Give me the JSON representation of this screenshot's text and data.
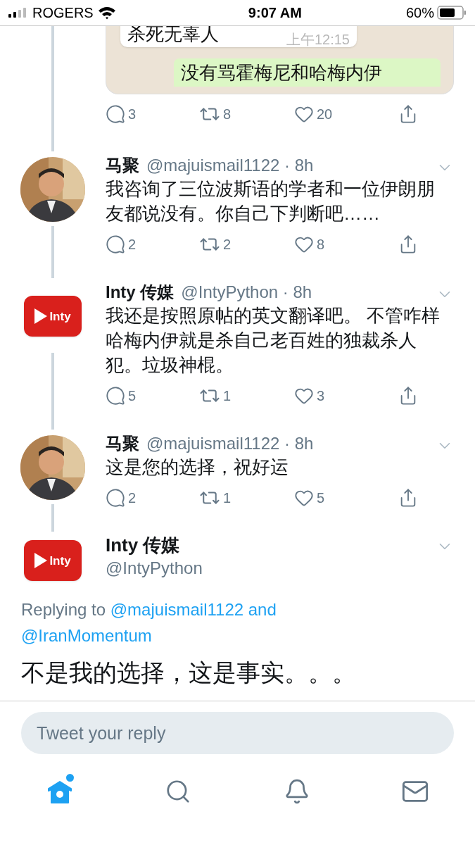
{
  "status_bar": {
    "carrier": "ROGERS",
    "time": "9:07 AM",
    "battery": "60%"
  },
  "embedded_chat": {
    "messages": [
      {
        "kind": "incoming",
        "text": "杀死无辜人",
        "time": "上午12:15"
      },
      {
        "kind": "outgoing",
        "text": "没有骂霍梅尼和哈梅内伊"
      }
    ]
  },
  "top_actions": {
    "replies": "3",
    "retweets": "8",
    "likes": "20"
  },
  "replies": [
    {
      "name": "马聚",
      "meta": "@majuismail1122 · 8h",
      "text": "我咨询了三位波斯语的学者和一位伊朗朋友都说没有。你自己下判断吧……",
      "replies": "2",
      "retweets": "2",
      "likes": "8"
    },
    {
      "avatar": {
        "kind": "logo",
        "logo_text": "Inty"
      },
      "name": "Inty 传媒",
      "meta": "@IntyPython · 8h",
      "text": "我还是按照原帖的英文翻译吧。 不管咋样哈梅内伊就是杀自己老百姓的独裁杀人犯。垃圾神棍。",
      "replies": "5",
      "retweets": "1",
      "likes": "3"
    },
    {
      "name": "马聚",
      "meta": "@majuismail1122 · 8h",
      "text": "这是您的选择，祝好运",
      "replies": "2",
      "retweets": "1",
      "likes": "5"
    }
  ],
  "main_tweet": {
    "avatar": {
      "kind": "logo",
      "logo_text": "Inty"
    },
    "name": "Inty 传媒",
    "handle": "@IntyPython",
    "replying": {
      "prefix": "Replying to",
      "mentions": [
        "@majuismail1122",
        "@IranMomentum"
      ],
      "joiner": "and"
    },
    "text": "不是我的选择，这是事实。。。"
  },
  "compose": {
    "placeholder": "Tweet your reply"
  },
  "nav": [
    {
      "kind": "home",
      "selected": true,
      "dot": true
    },
    {
      "kind": "search",
      "selected": false,
      "dot": false
    },
    {
      "kind": "bell",
      "selected": false,
      "dot": false
    },
    {
      "kind": "mail",
      "selected": false,
      "dot": false
    }
  ]
}
